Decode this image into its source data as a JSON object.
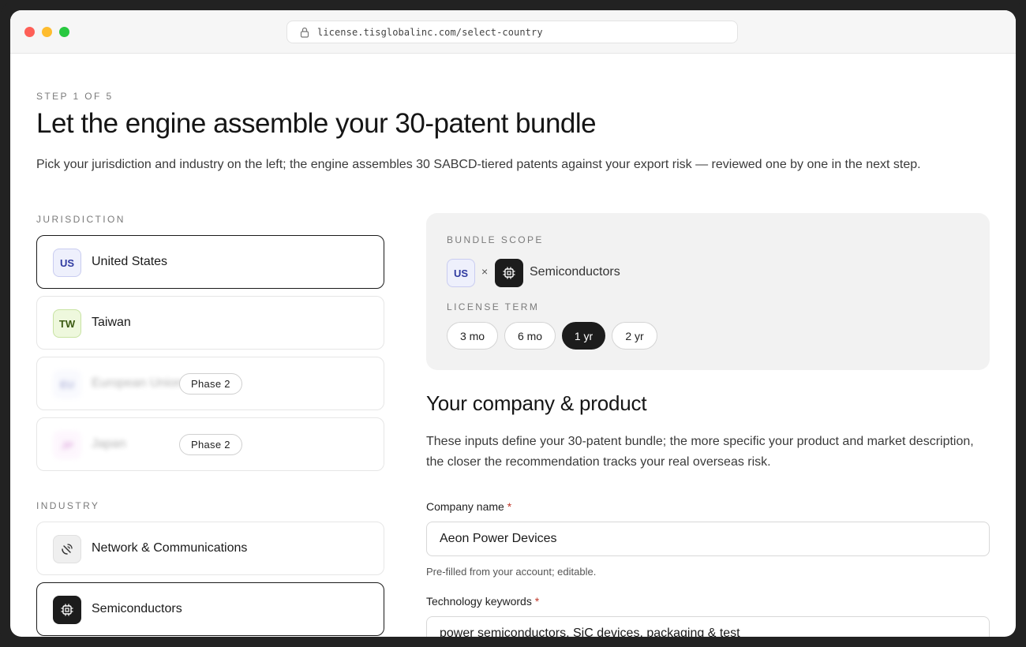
{
  "browser": {
    "url": "license.tisglobalinc.com/select-country"
  },
  "header": {
    "step": "STEP 1 OF 5",
    "title": "Let the engine assemble your 30-patent bundle",
    "subtitle": "Pick your jurisdiction and industry on the left; the engine assembles 30 SABCD-tiered patents against your export risk — reviewed one by one in the next step."
  },
  "jurisdiction": {
    "label": "JURISDICTION",
    "items": [
      {
        "code": "US",
        "name": "United States",
        "selected": true
      },
      {
        "code": "TW",
        "name": "Taiwan",
        "selected": false
      },
      {
        "code": "EU",
        "name": "European Union",
        "tag": "Phase 2",
        "disabled": true
      },
      {
        "code": "JP",
        "name": "Japan",
        "tag": "Phase 2",
        "disabled": true
      }
    ]
  },
  "industry": {
    "label": "INDUSTRY",
    "items": [
      {
        "name": "Network & Communications",
        "icon": "satellite-dish-icon",
        "selected": false
      },
      {
        "name": "Semiconductors",
        "icon": "chip-icon",
        "selected": true
      }
    ]
  },
  "scope": {
    "label": "BUNDLE SCOPE",
    "country_code": "US",
    "times": "×",
    "industry": "Semiconductors",
    "term_label": "LICENSE TERM",
    "terms": [
      "3 mo",
      "6 mo",
      "1 yr",
      "2 yr"
    ],
    "selected_term": "1 yr"
  },
  "company": {
    "heading": "Your company & product",
    "description": "These inputs define your 30-patent bundle; the more specific your product and market description, the closer the recommendation tracks your real overseas risk.",
    "company_name_label": "Company name",
    "required_mark": "*",
    "company_name_value": "Aeon Power Devices",
    "company_name_hint": "Pre-filled from your account; editable.",
    "keywords_label": "Technology keywords",
    "keywords_value": "power semiconductors, SiC devices, packaging & test"
  },
  "colors": {
    "accent_dark": "#1c1c1c",
    "us_badge": "#eef0fc",
    "tw_badge": "#eef8dd",
    "required": "#c0392b",
    "scope_panel": "#f2f2f2"
  }
}
